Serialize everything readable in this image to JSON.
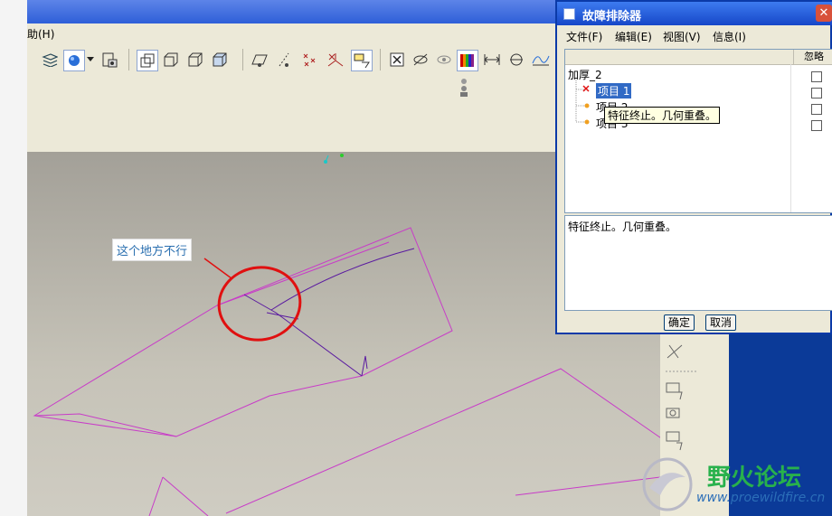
{
  "menubar": {
    "help_label": "助(H)"
  },
  "annotation": {
    "text": "这个地方不行"
  },
  "dialog": {
    "title": "故障排除器",
    "menu": [
      "文件(F)",
      "编辑(E)",
      "视图(V)",
      "信息(I)"
    ],
    "column_ignore": "忽略",
    "tree": {
      "root": "加厚_2",
      "items": [
        "项目 1",
        "项目 2",
        "项目 3"
      ]
    },
    "tooltip": "特征终止。几何重叠。",
    "message": "特征终止。几何重叠。",
    "ok_label": "确定",
    "cancel_label": "取消"
  },
  "watermark": {
    "name": "野火论坛",
    "url": "www.proewildfire.cn"
  },
  "colors": {
    "title_blue": "#1647c8",
    "curve_magenta": "#c83cc8",
    "curve_purple": "#5a1aa0",
    "annotation_red": "#e01010"
  }
}
